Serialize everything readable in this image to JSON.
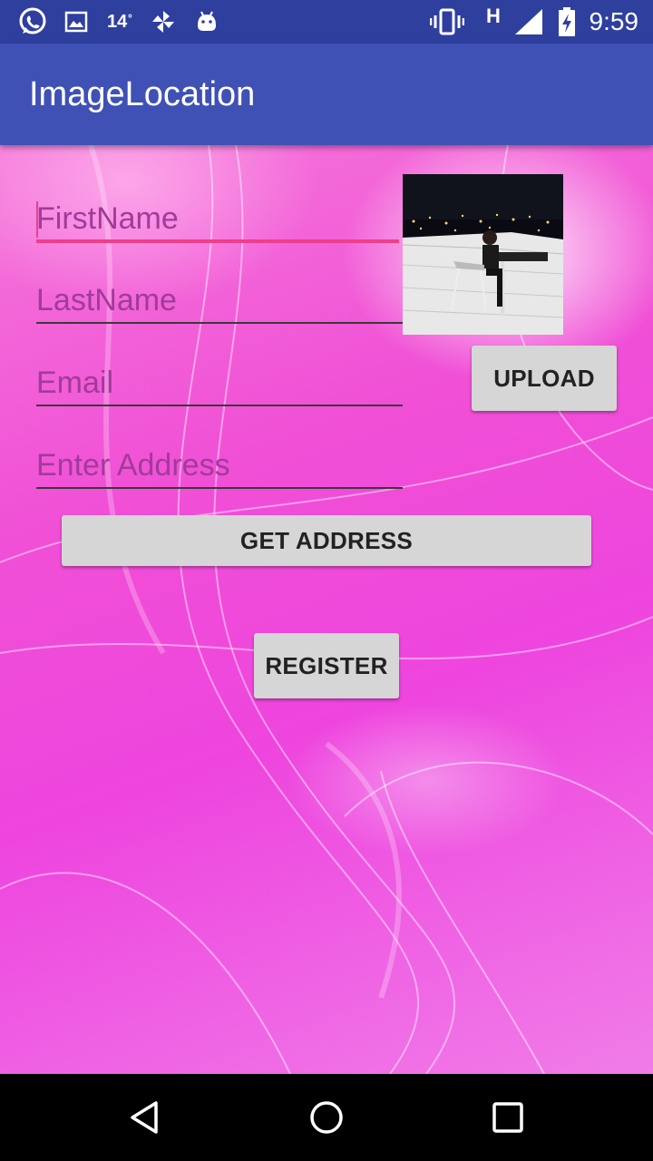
{
  "status_bar": {
    "icons": [
      "whatsapp-icon",
      "image-icon",
      "pinwheel-icon",
      "android-icon",
      "vibrate-icon",
      "signal-icon",
      "battery-charging-icon"
    ],
    "temperature": "14",
    "network_type": "H",
    "time": "9:59"
  },
  "app_bar": {
    "title": "ImageLocation"
  },
  "form": {
    "first_name": {
      "placeholder": "FirstName",
      "value": ""
    },
    "last_name": {
      "placeholder": "LastName",
      "value": ""
    },
    "email": {
      "placeholder": "Email",
      "value": ""
    },
    "address": {
      "placeholder": "Enter Address",
      "value": ""
    }
  },
  "buttons": {
    "upload": "UPLOAD",
    "get_address": "GET ADDRESS",
    "register": "REGISTER"
  },
  "nav_bar": {
    "icons": [
      "back-icon",
      "home-icon",
      "recents-icon"
    ]
  },
  "colors": {
    "status_bar": "#2f3f9e",
    "app_bar": "#3f51b5",
    "accent": "#ec3f8c",
    "background": "#f04fd6",
    "button": "#d6d6d6"
  }
}
